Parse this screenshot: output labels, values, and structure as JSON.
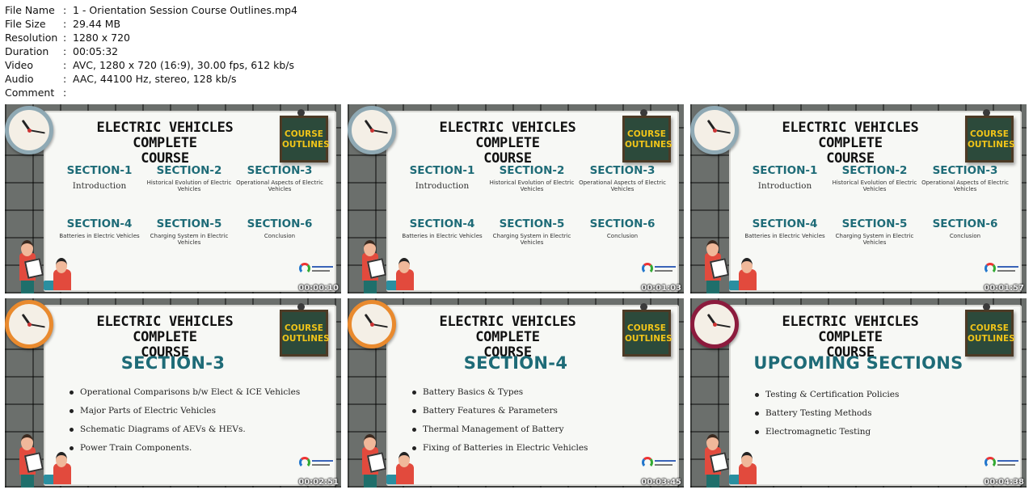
{
  "meta": [
    {
      "key": "File Name",
      "value": "1 - Orientation Session Course Outlines.mp4"
    },
    {
      "key": "File Size",
      "value": "29.44 MB"
    },
    {
      "key": "Resolution",
      "value": "1280 x 720"
    },
    {
      "key": "Duration",
      "value": "00:05:32"
    },
    {
      "key": "Video",
      "value": "AVC, 1280 x 720 (16:9), 30.00 fps, 612 kb/s"
    },
    {
      "key": "Audio",
      "value": "AAC, 44100 Hz, stereo, 128 kb/s"
    },
    {
      "key": "Comment",
      "value": ""
    }
  ],
  "slide_title_line1": "ELECTRIC VEHICLES COMPLETE",
  "slide_title_line2": "COURSE",
  "badge_line1": "COURSE",
  "badge_line2": "OUTLINES",
  "outline_sections": [
    {
      "head": "SECTION-1",
      "desc": "Introduction"
    },
    {
      "head": "SECTION-2",
      "desc": "Historical Evolution of Electric Vehicles"
    },
    {
      "head": "SECTION-3",
      "desc": "Operational Aspects of Electric Vehicles"
    },
    {
      "head": "SECTION-4",
      "desc": "Batteries in Electric Vehicles"
    },
    {
      "head": "SECTION-5",
      "desc": "Charging System in Electric Vehicles"
    },
    {
      "head": "SECTION-6",
      "desc": "Conclusion"
    }
  ],
  "thumbnails": [
    {
      "timestamp": "00:00:10"
    },
    {
      "timestamp": "00:01:03"
    },
    {
      "timestamp": "00:01:57"
    },
    {
      "timestamp": "00:02:51",
      "heading": "SECTION-3",
      "bullets": [
        "Operational Comparisons b/w Elect & ICE Vehicles",
        "Major Parts of Electric Vehicles",
        "Schematic Diagrams of AEVs & HEVs.",
        "Power Train Components."
      ]
    },
    {
      "timestamp": "00:03:45",
      "heading": "SECTION-4",
      "bullets": [
        "Battery Basics & Types",
        "Battery Features & Parameters",
        "Thermal Management of Battery",
        "Fixing of Batteries in Electric Vehicles"
      ]
    },
    {
      "timestamp": "00:04:38",
      "heading": "UPCOMING SECTIONS",
      "bullets": [
        "Testing & Certification Policies",
        "Battery Testing Methods",
        "Electromagnetic Testing"
      ]
    }
  ]
}
